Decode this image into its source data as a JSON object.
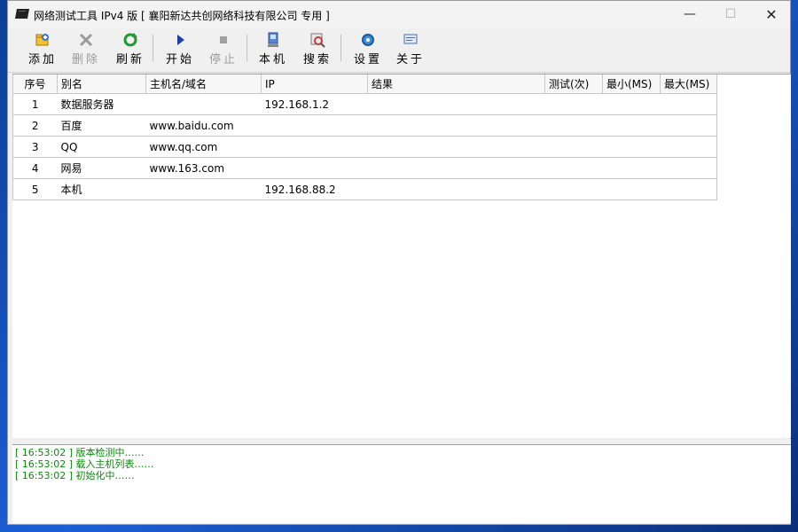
{
  "window": {
    "title": "网络测试工具 IPv4 版 [ 襄阳新达共创网络科技有限公司 专用 ]",
    "min_glyph": "—",
    "max_glyph": "☐",
    "close_glyph": "✕"
  },
  "toolbar": {
    "add": "添加",
    "delete": "删除",
    "refresh": "刷新",
    "start": "开始",
    "stop": "停止",
    "local": "本机",
    "search": "搜索",
    "settings": "设置",
    "about": "关于"
  },
  "table": {
    "headers": {
      "seq": "序号",
      "alias": "别名",
      "host": "主机名/域名",
      "ip": "IP",
      "result": "结果",
      "tests": "测试(次)",
      "min": "最小(MS)",
      "max": "最大(MS)"
    },
    "rows": [
      {
        "seq": "1",
        "alias": "数据服务器",
        "host": "",
        "ip": "192.168.1.2",
        "result": "",
        "tests": "",
        "min": "",
        "max": ""
      },
      {
        "seq": "2",
        "alias": "百度",
        "host": "www.baidu.com",
        "ip": "",
        "result": "",
        "tests": "",
        "min": "",
        "max": ""
      },
      {
        "seq": "3",
        "alias": "QQ",
        "host": "www.qq.com",
        "ip": "",
        "result": "",
        "tests": "",
        "min": "",
        "max": ""
      },
      {
        "seq": "4",
        "alias": "网易",
        "host": "www.163.com",
        "ip": "",
        "result": "",
        "tests": "",
        "min": "",
        "max": ""
      },
      {
        "seq": "5",
        "alias": "本机",
        "host": "",
        "ip": "192.168.88.2",
        "result": "",
        "tests": "",
        "min": "",
        "max": ""
      }
    ]
  },
  "log": [
    "[ 16:53:02 ] 版本检测中……",
    "[ 16:53:02 ] 载入主机列表……",
    "[ 16:53:02 ] 初始化中……"
  ],
  "colors": {
    "log_text": "#0a8a0a",
    "desktop": "#1c5fd6"
  }
}
